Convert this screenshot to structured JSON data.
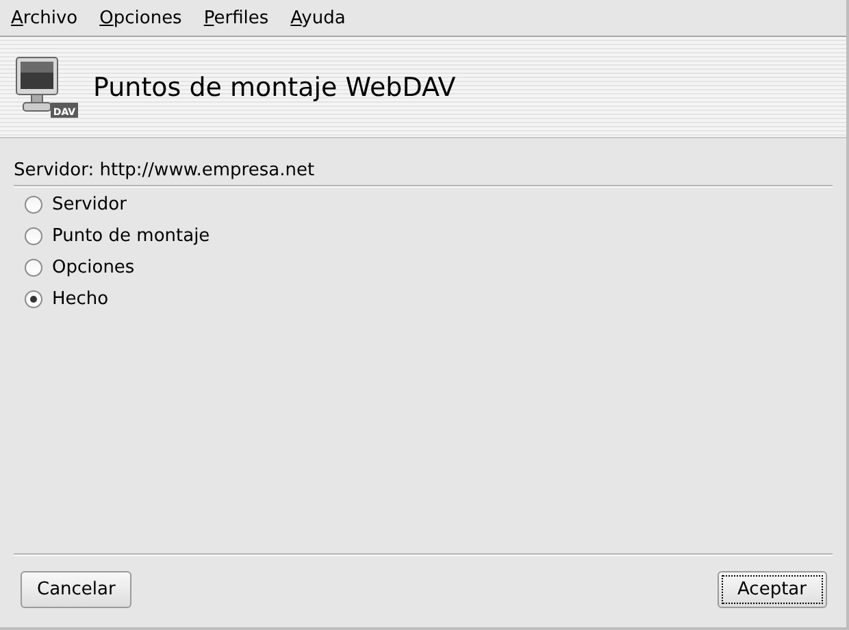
{
  "menu": [
    {
      "label": "Archivo"
    },
    {
      "label": "Opciones"
    },
    {
      "label": "Perfiles"
    },
    {
      "label": "Ayuda"
    }
  ],
  "header": {
    "title": "Puntos de montaje WebDAV",
    "icon_badge": "DAV"
  },
  "server_line": "Servidor: http://www.empresa.net",
  "steps": [
    {
      "label": "Servidor",
      "selected": false
    },
    {
      "label": "Punto de montaje",
      "selected": false
    },
    {
      "label": "Opciones",
      "selected": false
    },
    {
      "label": "Hecho",
      "selected": true
    }
  ],
  "buttons": [
    {
      "label": "Cancelar",
      "focused": false
    },
    {
      "label": "Aceptar",
      "focused": true
    }
  ]
}
